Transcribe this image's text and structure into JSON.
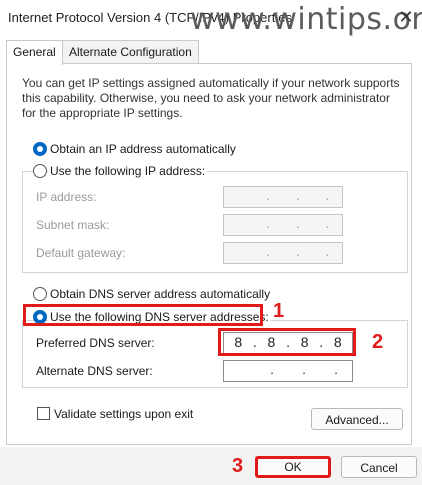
{
  "window": {
    "title": "Internet Protocol Version 4 (TCP/IPv4) Properties",
    "watermark": "www.wintips.org",
    "close_icon": "close-icon"
  },
  "tabs": [
    {
      "label": "General",
      "active": true
    },
    {
      "label": "Alternate Configuration",
      "active": false
    }
  ],
  "description": "You can get IP settings assigned automatically if your network supports this capability. Otherwise, you need to ask your network administrator for the appropriate IP settings.",
  "ip": {
    "auto_label": "Obtain an IP address automatically",
    "manual_label": "Use the following IP address:",
    "fields": [
      {
        "label": "IP address:",
        "value": ""
      },
      {
        "label": "Subnet mask:",
        "value": ""
      },
      {
        "label": "Default gateway:",
        "value": ""
      }
    ]
  },
  "dns": {
    "auto_label": "Obtain DNS server address automatically",
    "manual_label": "Use the following DNS server addresses:",
    "preferred_label": "Preferred DNS server:",
    "preferred_octets": [
      "8",
      "8",
      "8",
      "8"
    ],
    "alternate_label": "Alternate DNS server:",
    "alternate_octets": [
      "",
      "",
      "",
      ""
    ]
  },
  "validate_label": "Validate settings upon exit",
  "buttons": {
    "advanced": "Advanced...",
    "ok": "OK",
    "cancel": "Cancel"
  },
  "annotations": {
    "step1": "1",
    "step2": "2",
    "step3": "3",
    "color": "#e11b1b"
  },
  "accent": "#0067c0"
}
